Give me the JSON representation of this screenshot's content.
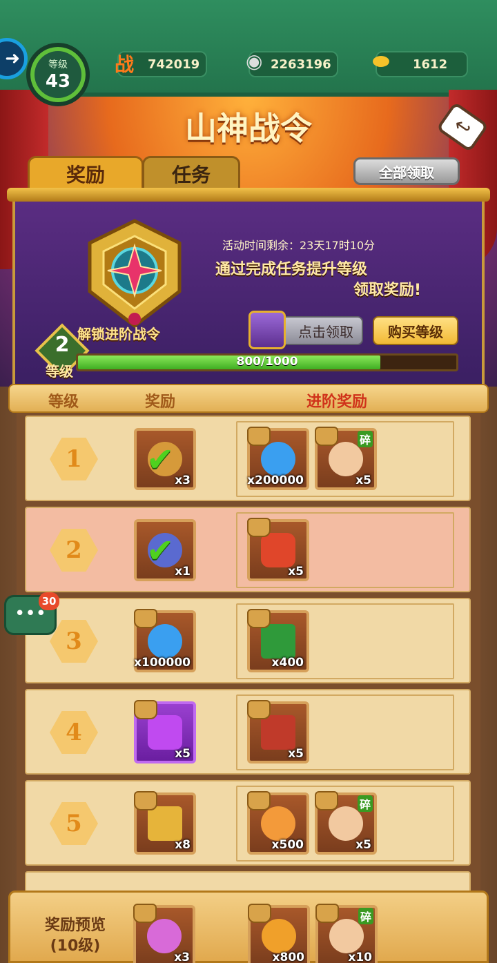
{
  "header": {
    "level_label": "等级",
    "level_value": "43",
    "combat_icon": "战",
    "combat_value": "742019",
    "silver_value": "2263196",
    "gold_value": "1612"
  },
  "banner": {
    "title": "山神战令",
    "tabs": [
      {
        "label": "奖励",
        "active": true
      },
      {
        "label": "任务",
        "active": false
      }
    ],
    "claim_all_label": "全部领取",
    "unlock_caption": "解锁进阶战令",
    "time_left": "活动时间剩余：23天17时10分",
    "desc_line1": "通过完成任务提升等级",
    "desc_line2": "领取奖励!",
    "click_claim_label": "点击领取",
    "buy_level_label": "购买等级",
    "current_level": "2",
    "level_word": "等级",
    "xp_text": "800/1000",
    "xp_fraction": 0.8
  },
  "table": {
    "headers": [
      "等级",
      "奖励",
      "进阶奖励"
    ],
    "rows": [
      {
        "level": "1",
        "free": {
          "qty": "x3",
          "icon": "gourd-icon",
          "claimed": true
        },
        "premium": [
          {
            "qty": "x200000",
            "icon": "blue-potion-icon",
            "locked": true
          },
          {
            "qty": "x5",
            "icon": "hero-fragment-icon",
            "locked": true,
            "fragment_label": "碎"
          }
        ]
      },
      {
        "level": "2",
        "free": {
          "qty": "x1",
          "icon": "gourd-icon",
          "claimed": true
        },
        "premium": [
          {
            "qty": "x5",
            "icon": "red-gem-icon",
            "locked": true
          }
        ]
      },
      {
        "level": "3",
        "free": {
          "qty": "x100000",
          "icon": "blue-potion-icon",
          "locked": true
        },
        "premium": [
          {
            "qty": "x400",
            "icon": "green-leaf-icon",
            "locked": true
          }
        ]
      },
      {
        "level": "4",
        "free": {
          "qty": "x5",
          "icon": "purple-gem-icon",
          "locked": true
        },
        "premium": [
          {
            "qty": "x5",
            "icon": "treasure-chest-icon",
            "locked": true
          }
        ]
      },
      {
        "level": "5",
        "free": {
          "qty": "x8",
          "icon": "treasure-chest-icon",
          "locked": true
        },
        "premium": [
          {
            "qty": "x500",
            "icon": "peach-icon",
            "locked": true
          },
          {
            "qty": "x5",
            "icon": "hero-fragment-icon",
            "locked": true,
            "fragment_label": "碎"
          }
        ]
      }
    ]
  },
  "chat": {
    "badge": "30"
  },
  "preview": {
    "title": "奖励预览",
    "subtitle": "(10级)",
    "free": {
      "qty": "x3",
      "icon": "gourd-icon"
    },
    "premium": [
      {
        "qty": "x800",
        "icon": "flame-orb-icon"
      },
      {
        "qty": "x10",
        "icon": "hero-fragment-icon",
        "fragment_label": "碎"
      }
    ]
  },
  "colors": {
    "green_bar": "#2f8e5f",
    "xp_fill": "#3fae22",
    "current_row": "#f3bca2",
    "row": "#f1d9a6"
  }
}
